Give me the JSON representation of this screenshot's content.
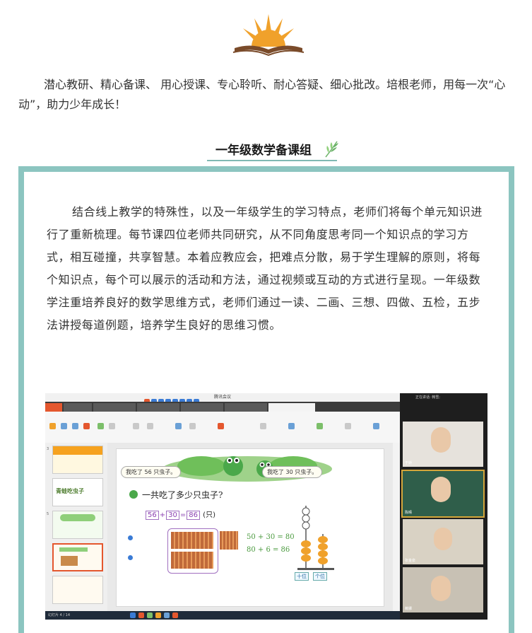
{
  "intro": {
    "text": "潜心教研、精心备课、 用心授课、专心聆听、耐心答疑、细心批改。培根老师，用每一次“心动”，助力少年成长！"
  },
  "section": {
    "title": "一年级数学备课组"
  },
  "body": {
    "text": "结合线上教学的特殊性，以及一年级学生的学习特点，老师们将每个单元知识进行了重新梳理。每节课四位老师共同研究，从不同角度思考同一个知识点的学习方式，相互碰撞，共享智慧。本着应教应会，把难点分散，易于学生理解的原则，将每个知识点，每个可以展示的活动和方法，通过视频或互动的方式进行呈现。一年级数学注重培养良好的数学思维方式，老师们通过一读、二画、三想、四做、五检，五步法讲授每道例题，培养学生良好的思维习惯。"
  },
  "screenshot": {
    "window_title": "腾讯会议",
    "video_panel_header": "正在讲话: 韩雪;",
    "participants": [
      "于娇",
      "陈晴",
      "张金泉",
      "薇娜"
    ],
    "thumb_title": "青蛙吃虫子",
    "statusbar": "幻灯片 4 / 14",
    "slide": {
      "bubble_left": "我吃了 56 只虫子。",
      "bubble_right": "我吃了 30 只虫子。",
      "question": "一共吃了多少只虫子?",
      "eq_a": "56",
      "eq_b": "30",
      "eq_c": "86",
      "eq_unit": "(只)",
      "calc1": "50 + 30 = 80",
      "calc2": "80 + 6 = 86",
      "abacus_tens": "十位",
      "abacus_ones": "个位"
    }
  },
  "colors": {
    "frame": "#8cc5c0",
    "logo_orange": "#f0a12b",
    "book_brown": "#7a4b2a"
  }
}
